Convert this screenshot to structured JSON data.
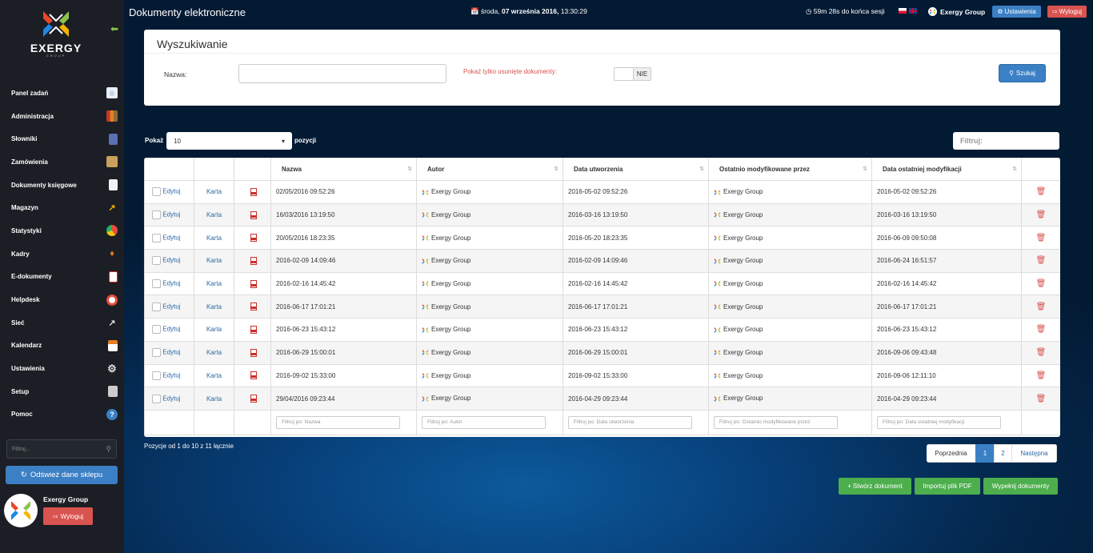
{
  "app": {
    "title": "Dokumenty elektroniczne",
    "brand": "EXERGY",
    "brand_sub": "GROUP"
  },
  "topbar": {
    "datetime_day": "środa,",
    "datetime_date": "07 września 2016,",
    "datetime_time": "13:30:29",
    "session_time": "59m 28s",
    "session_suffix": "do końca sesji",
    "user": "Exergy Group",
    "settings_label": "Ustawienia",
    "logout_label": "Wyloguj"
  },
  "sidebar": {
    "items": [
      {
        "label": "Panel zadań",
        "icon": "home-icon"
      },
      {
        "label": "Administracja",
        "icon": "books-icon"
      },
      {
        "label": "Słowniki",
        "icon": "book-icon"
      },
      {
        "label": "Zamówienia",
        "icon": "box-icon"
      },
      {
        "label": "Dokumenty księgowe",
        "icon": "document-icon"
      },
      {
        "label": "Magazyn",
        "icon": "forklift-icon"
      },
      {
        "label": "Statystyki",
        "icon": "pie-chart-icon"
      },
      {
        "label": "Kadry",
        "icon": "tie-icon"
      },
      {
        "label": "E-dokumenty",
        "icon": "pdf-icon"
      },
      {
        "label": "Helpdesk",
        "icon": "lifebuoy-icon"
      },
      {
        "label": "Sieć",
        "icon": "network-icon"
      },
      {
        "label": "Kalendarz",
        "icon": "calendar-icon"
      },
      {
        "label": "Ustawienia",
        "icon": "gear-icon"
      },
      {
        "label": "Setup",
        "icon": "setup-icon"
      },
      {
        "label": "Pomoc",
        "icon": "help-icon"
      }
    ],
    "filter_placeholder": "Filtruj...",
    "refresh_label": "Odśwież dane sklepu",
    "user_name": "Exergy Group",
    "logout_label": "Wyloguj"
  },
  "search": {
    "title": "Wyszukiwanie",
    "name_label": "Nazwa:",
    "name_value": "",
    "deleted_label": "Pokaż tylko usunięte dokumenty:",
    "deleted_value": "NIE",
    "button_label": "Szukaj"
  },
  "list": {
    "show_label": "Pokaż",
    "page_size": "10",
    "positions_label": "pozycji",
    "filter_label": "Filtruj:"
  },
  "table": {
    "headers": [
      "",
      "",
      "",
      "Nazwa",
      "Autor",
      "Data utworzenia",
      "Ostatnio modyfikowane przez",
      "Data ostatniej modyfikacji",
      ""
    ],
    "edit_label": "Edytuj",
    "card_label": "Karta",
    "rows": [
      {
        "name": "02/05/2016 09:52:26",
        "author": "Exergy Group",
        "created": "2016-05-02 09:52:26",
        "modified_by": "Exergy Group",
        "modified": "2016-05-02 09:52:26"
      },
      {
        "name": "16/03/2016 13:19:50",
        "author": "Exergy Group",
        "created": "2016-03-16 13:19:50",
        "modified_by": "Exergy Group",
        "modified": "2016-03-16 13:19:50"
      },
      {
        "name": "20/05/2016 18:23:35",
        "author": "Exergy Group",
        "created": "2016-05-20 18:23:35",
        "modified_by": "Exergy Group",
        "modified": "2016-06-09 09:50:08"
      },
      {
        "name": "2016-02-09 14:09:46",
        "author": "Exergy Group",
        "created": "2016-02-09 14:09:46",
        "modified_by": "Exergy Group",
        "modified": "2016-06-24 16:51:57"
      },
      {
        "name": "2016-02-16 14:45:42",
        "author": "Exergy Group",
        "created": "2016-02-16 14:45:42",
        "modified_by": "Exergy Group",
        "modified": "2016-02-16 14:45:42"
      },
      {
        "name": "2016-06-17 17:01:21",
        "author": "Exergy Group",
        "created": "2016-06-17 17:01:21",
        "modified_by": "Exergy Group",
        "modified": "2016-06-17 17:01:21"
      },
      {
        "name": "2016-06-23 15:43:12",
        "author": "Exergy Group",
        "created": "2016-06-23 15:43:12",
        "modified_by": "Exergy Group",
        "modified": "2016-06-23 15:43:12"
      },
      {
        "name": "2016-06-29 15:00:01",
        "author": "Exergy Group",
        "created": "2016-06-29 15:00:01",
        "modified_by": "Exergy Group",
        "modified": "2016-09-06 09:43:48"
      },
      {
        "name": "2016-09-02 15:33:00",
        "author": "Exergy Group",
        "created": "2016-09-02 15:33:00",
        "modified_by": "Exergy Group",
        "modified": "2016-09-06 12:11:10"
      },
      {
        "name": "29/04/2016 09:23:44",
        "author": "Exergy Group",
        "created": "2016-04-29 09:23:44",
        "modified_by": "Exergy Group",
        "modified": "2016-04-29 09:23:44"
      }
    ],
    "filters": [
      "Filtruj po: Nazwa",
      "Filtruj po: Autor",
      "Filtruj po: Data utworzenia",
      "Filtruj po: Ostatnio modyfikowane przez",
      "Filtruj po: Data ostatniej modyfikacji"
    ]
  },
  "pagination": {
    "info": "Pozycje od 1 do 10 z 11 łącznie",
    "prev": "Poprzednia",
    "pages": [
      "1",
      "2"
    ],
    "active": "1",
    "next": "Następna"
  },
  "actions": {
    "create": "Stwórz dokument",
    "import": "Importuj plik PDF",
    "fill": "Wypełnij dokumenty"
  },
  "colors": {
    "sidebar": "#1b1e24",
    "primary": "#3b7fc4",
    "danger": "#d9534f",
    "success": "#4cae4c",
    "accent_green": "#8bc34a"
  }
}
